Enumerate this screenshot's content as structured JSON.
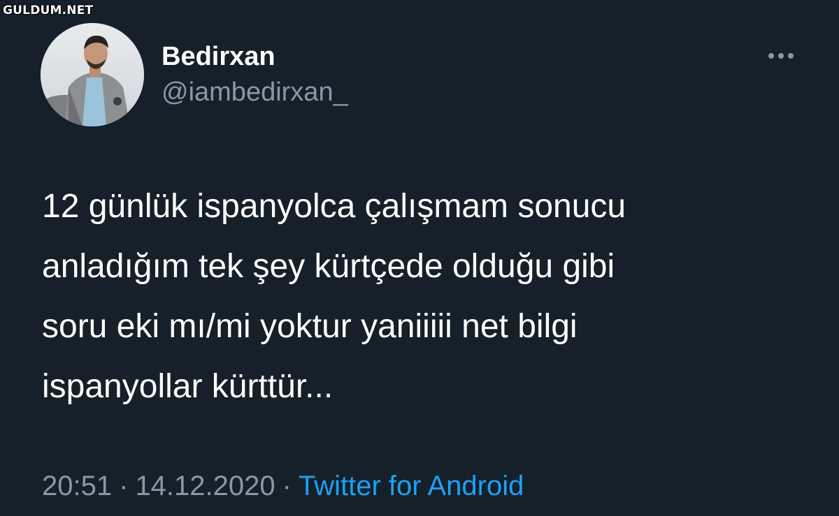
{
  "watermark": "GULDUM.NET",
  "author": {
    "display_name": "Bedirxan",
    "handle": "@iambedirxan_",
    "avatar_icon": "user-avatar-photo"
  },
  "more_icon": "more-horizontal-icon",
  "tweet": {
    "lines": [
      "12 günlük ispanyolca çalışmam sonucu",
      "anladığım tek şey kürtçede olduğu gibi",
      "soru eki mı/mi yoktur yaniiiii net bilgi",
      "ispanyollar kürttür..."
    ]
  },
  "meta": {
    "time": "20:51",
    "date": "14.12.2020",
    "separator": "·",
    "source": "Twitter for Android"
  },
  "colors": {
    "background": "#15202b",
    "text": "#ffffff",
    "secondary": "#8899a6",
    "link": "#1da1f2"
  }
}
